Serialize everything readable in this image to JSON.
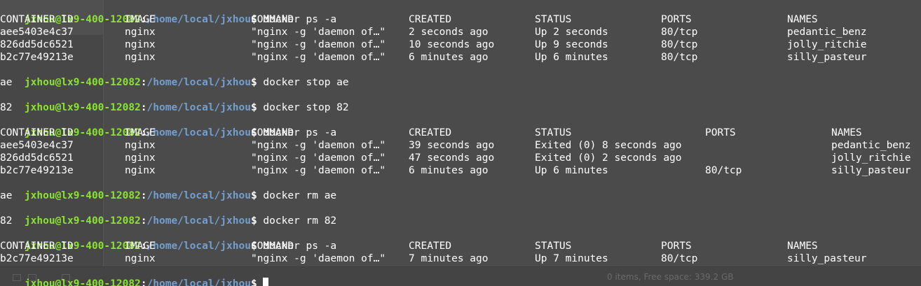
{
  "background_ghost": {
    "status_text": "0 items, Free space: 339.2 GB"
  },
  "prompt": {
    "user": "jxhou@lx9-400-12082",
    "sep": ":",
    "path": "/home/local/jxhou",
    "dollar": "$"
  },
  "colors": {
    "prompt_user": "#8ae234",
    "prompt_path": "#729fcf",
    "text": "#ffffff",
    "background": "#4b4b4b"
  },
  "commands": [
    "docker ps -a",
    "docker stop ae",
    "docker stop 82",
    "docker ps -a",
    "docker rm ae",
    "docker rm 82",
    "docker ps -a",
    ""
  ],
  "outputs": {
    "stop_ae": "ae",
    "stop_82": "82",
    "rm_ae": "ae",
    "rm_82": "82"
  },
  "table1": {
    "headers": [
      "CONTAINER ID",
      "IMAGE",
      "COMMAND",
      "CREATED",
      "STATUS",
      "PORTS",
      "NAMES"
    ],
    "rows": [
      [
        "aee5403e4c37",
        "nginx",
        "\"nginx -g 'daemon of…\"",
        "2 seconds ago",
        "Up 2 seconds",
        "80/tcp",
        "pedantic_benz"
      ],
      [
        "826dd5dc6521",
        "nginx",
        "\"nginx -g 'daemon of…\"",
        "10 seconds ago",
        "Up 9 seconds",
        "80/tcp",
        "jolly_ritchie"
      ],
      [
        "b2c77e49213e",
        "nginx",
        "\"nginx -g 'daemon of…\"",
        "6 minutes ago",
        "Up 6 minutes",
        "80/tcp",
        "silly_pasteur"
      ]
    ]
  },
  "table2": {
    "headers": [
      "CONTAINER ID",
      "IMAGE",
      "COMMAND",
      "CREATED",
      "STATUS",
      "PORTS",
      "NAMES"
    ],
    "rows": [
      [
        "aee5403e4c37",
        "nginx",
        "\"nginx -g 'daemon of…\"",
        "39 seconds ago",
        "Exited (0) 8 seconds ago",
        "",
        "pedantic_benz"
      ],
      [
        "826dd5dc6521",
        "nginx",
        "\"nginx -g 'daemon of…\"",
        "47 seconds ago",
        "Exited (0) 2 seconds ago",
        "",
        "jolly_ritchie"
      ],
      [
        "b2c77e49213e",
        "nginx",
        "\"nginx -g 'daemon of…\"",
        "6 minutes ago",
        "Up 6 minutes",
        "80/tcp",
        "silly_pasteur"
      ]
    ]
  },
  "table3": {
    "headers": [
      "CONTAINER ID",
      "IMAGE",
      "COMMAND",
      "CREATED",
      "STATUS",
      "PORTS",
      "NAMES"
    ],
    "rows": [
      [
        "b2c77e49213e",
        "nginx",
        "\"nginx -g 'daemon of…\"",
        "7 minutes ago",
        "Up 7 minutes",
        "80/tcp",
        "silly_pasteur"
      ]
    ]
  }
}
